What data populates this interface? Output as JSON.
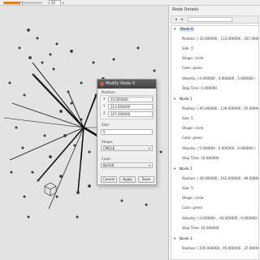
{
  "toolbar": {
    "time_slider_fraction": 0.45,
    "spin_value": "20",
    "spin_arrow": "▾"
  },
  "panel": {
    "title": "Node Details",
    "toolbar_back": "◂",
    "toolbar_forward": "▸",
    "nodes": [
      {
        "header": "Node 0",
        "selected": true,
        "position": "Position: ( 35.000000 , 113.000000 , 107.000000 )",
        "size": "Size: 5",
        "shape": "Shape: circle",
        "color": "Color: green",
        "velocity": "Velocity: ( 0.000000 , 0.000000 , 5.000000 )",
        "stop_time": "Stop Time: 0.000000"
      },
      {
        "header": "Node 1",
        "selected": false,
        "position": "Position: ( 95.000000 , 139.000000 , 65.000000 )",
        "size": "Size: 5",
        "shape": "Shape: circle",
        "color": "Color: green",
        "velocity": "Velocity: ( 5.000000 , 0.000000 , 0.000000 )",
        "stop_time": "Stop Time: 10.000000"
      },
      {
        "header": "Node 2",
        "selected": false,
        "position": "Position: ( 49.000000 , 162.000000 , 96.000000 )",
        "size": "Size: 5",
        "shape": "Shape: circle",
        "color": "Color: green",
        "velocity": "Velocity: ( 0.000000 , -40.000000 , 0.000000 )",
        "stop_time": "Stop Time: 10.000000"
      },
      {
        "header": "Node 3",
        "selected": false,
        "position": "Position: ( 195.000000 , 95.000000 , 37.000000 )",
        "size": "",
        "shape": "",
        "color": "",
        "velocity": "",
        "stop_time": ""
      }
    ]
  },
  "dialog": {
    "title": "Modify Node 0",
    "position_label": "Position:",
    "x_label": "X",
    "x_value": "35.000000",
    "y_label": "Y",
    "y_value": "113.000000",
    "z_label": "Z",
    "z_value": "107.000000",
    "size_label": "Size:",
    "size_value": "5",
    "shape_label": "Shape:",
    "shape_value": "CIRCLE",
    "color_label": "Color:",
    "color_value": "BLACK",
    "dropdown_arrow": "▾",
    "cancel_label": "Cancel",
    "apply_label": "Apply",
    "save_label": "Save"
  },
  "colors": {
    "canvas_background": "#e3e3e3",
    "node_dots": "#3a3a3a",
    "edges": "#111111",
    "close_button": "#e25535",
    "slider_accent": "#e08020",
    "selection": "#d6e6f7"
  }
}
